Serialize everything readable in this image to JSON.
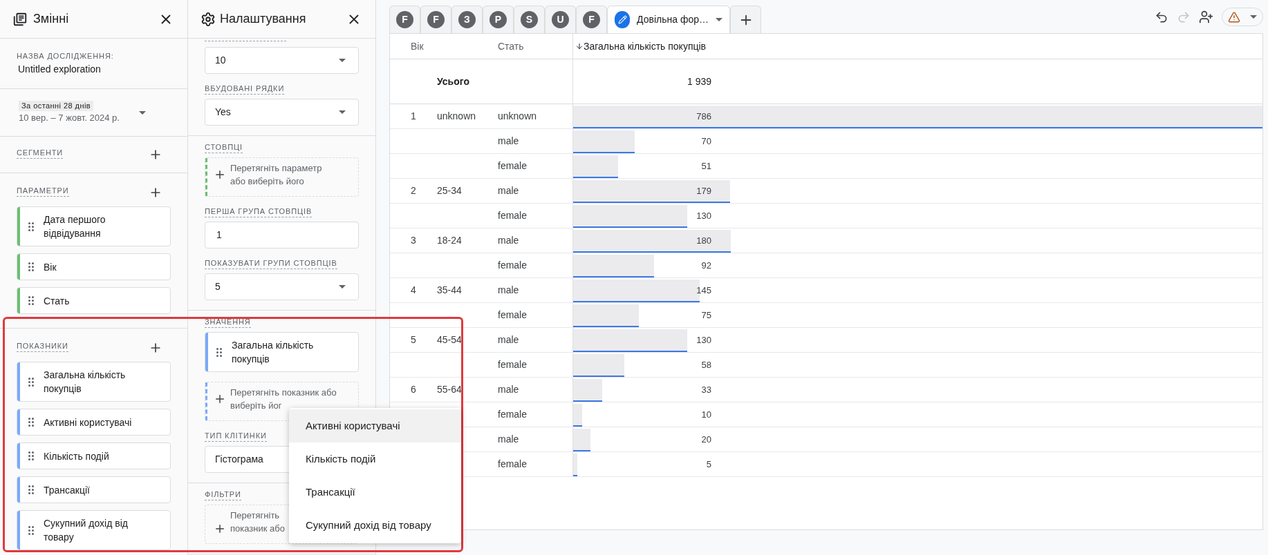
{
  "variables_panel": {
    "title": "Змінні",
    "name_label": "НАЗВА ДОСЛІДЖЕННЯ:",
    "name": "Untitled exploration",
    "date_badge": "За останні 28 днів",
    "date_range": "10 вер. – 7 жовт. 2024 р.",
    "sections": [
      {
        "kind": "segments",
        "label": "СЕГМЕНТИ"
      },
      {
        "kind": "dimensions",
        "label": "ПАРАМЕТРИ",
        "items": [
          "Дата першого відвідування",
          "Вік",
          "Стать"
        ]
      },
      {
        "kind": "metrics",
        "label": "ПОКАЗНИКИ",
        "items": [
          "Загальна кількість покупців",
          "Активні користувачі",
          "Кількість подій",
          "Трансакції",
          "Сукупний дохід від товару"
        ]
      }
    ]
  },
  "settings_panel": {
    "title": "Налаштування",
    "groups": [
      {
        "fields": [
          {
            "kind": "select",
            "value": "10"
          },
          {
            "kind": "select",
            "label": "ВБУДОВАНІ РЯДКИ",
            "value": "Yes"
          }
        ]
      },
      {
        "fields": [
          {
            "kind": "dimension-dropzone",
            "label": "СТОВПЦІ",
            "lines": [
              "Перетягніть параметр",
              "або виберіть його"
            ]
          },
          {
            "kind": "input",
            "label": "ПЕРША ГРУПА СТОВПЦІВ",
            "value": "1"
          },
          {
            "kind": "select",
            "label": "ПОКАЗУВАТИ ГРУПИ СТОВПЦІВ",
            "value": "5"
          }
        ]
      },
      {
        "fields": [
          {
            "kind": "metric-chip",
            "label": "ЗНАЧЕННЯ",
            "text": "Загальна кількість покупців"
          },
          {
            "kind": "metric-dropzone",
            "lines": [
              "Перетягніть показник або",
              "виберіть йог"
            ]
          },
          {
            "kind": "select",
            "label": "ТИП КЛІТИНКИ",
            "value": "Гістограма"
          }
        ]
      },
      {
        "fields": [
          {
            "kind": "filter-dropzone",
            "label": "ФІЛЬТРИ",
            "lines": [
              "Перетягніть",
              "показник або"
            ]
          }
        ]
      }
    ]
  },
  "tabs": [
    {
      "kind": "letter",
      "label": "F",
      "selected": false
    },
    {
      "kind": "letter",
      "label": "F",
      "selected": false
    },
    {
      "kind": "letter",
      "label": "З",
      "selected": false
    },
    {
      "kind": "letter",
      "label": "P",
      "selected": false
    },
    {
      "kind": "letter",
      "label": "S",
      "selected": false
    },
    {
      "kind": "letter",
      "label": "U",
      "selected": false
    },
    {
      "kind": "letter",
      "label": "F",
      "selected": false
    },
    {
      "kind": "edit",
      "label": "Довільна фор…",
      "selected": true
    }
  ],
  "toolbar": {
    "undo": {
      "disabled": false
    },
    "redo": {
      "disabled": true
    }
  },
  "table": {
    "columns": [
      "Вік",
      "Стать",
      "Загальна кількість покупців"
    ],
    "totals": {
      "label": "Усього",
      "value": "1 939"
    },
    "rows": [
      {
        "index": "1",
        "age": "unknown",
        "gender": "unknown",
        "value": "786",
        "level": 1
      },
      {
        "gender": "male",
        "value": "70",
        "level": 0.089
      },
      {
        "gender": "female",
        "value": "51",
        "level": 0.065
      },
      {
        "index": "2",
        "age": "25-34",
        "gender": "male",
        "value": "179",
        "level": 0.228
      },
      {
        "gender": "female",
        "value": "130",
        "level": 0.165
      },
      {
        "index": "3",
        "age": "18-24",
        "gender": "male",
        "value": "180",
        "level": 0.229
      },
      {
        "gender": "female",
        "value": "92",
        "level": 0.117
      },
      {
        "index": "4",
        "age": "35-44",
        "gender": "male",
        "value": "145",
        "level": 0.184
      },
      {
        "gender": "female",
        "value": "75",
        "level": 0.095
      },
      {
        "index": "5",
        "age": "45-54",
        "gender": "male",
        "value": "130",
        "level": 0.165
      },
      {
        "gender": "female",
        "value": "58",
        "level": 0.074
      },
      {
        "index": "6",
        "age": "55-64",
        "gender": "male",
        "value": "33",
        "level": 0.042
      },
      {
        "gender": "female",
        "value": "10",
        "level": 0.013
      },
      {
        "gender": "male",
        "value": "20",
        "level": 0.025
      },
      {
        "gender": "female",
        "value": "5",
        "level": 0.006
      }
    ]
  },
  "menu": {
    "items": [
      {
        "label": "Активні користувачі",
        "highlighted": true
      },
      {
        "label": "Кількість подій",
        "highlighted": false
      },
      {
        "label": "Трансакції",
        "highlighted": false
      },
      {
        "label": "Сукупний дохід від товару",
        "highlighted": false
      }
    ]
  }
}
